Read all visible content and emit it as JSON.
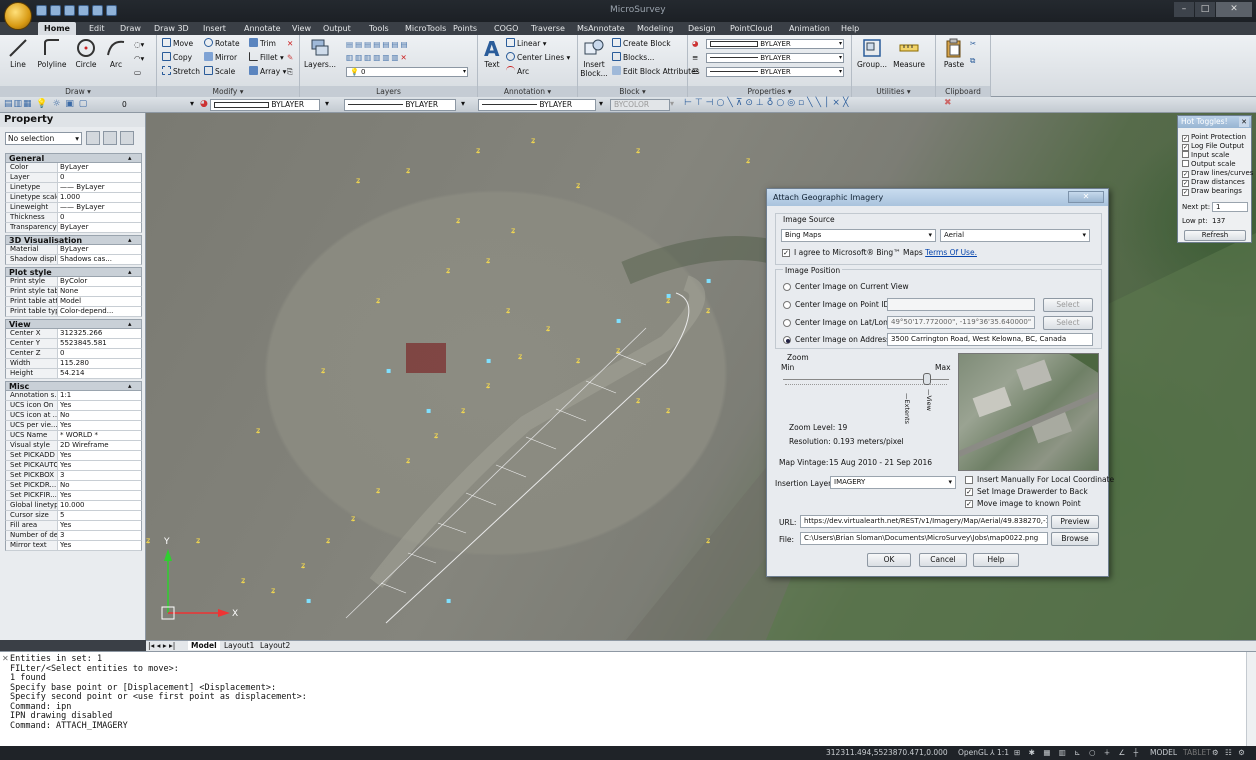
{
  "window": {
    "title": "MicroSurvey",
    "controls": [
      "–",
      "□",
      "✕"
    ]
  },
  "ribbon_tabs": [
    "Home",
    "Edit",
    "Draw",
    "Draw 3D",
    "Insert",
    "Annotate",
    "View",
    "Output",
    "Tools",
    "MicroTools",
    "Points",
    "COGO",
    "Traverse",
    "MsAnnotate",
    "Modeling",
    "Design",
    "PointCloud",
    "Animation",
    "Help"
  ],
  "ribbon": {
    "draw": {
      "label": "Draw",
      "line": "Line",
      "polyline": "Polyline",
      "circle": "Circle",
      "arc": "Arc"
    },
    "modify": {
      "label": "Modify",
      "move": "Move",
      "rotate": "Rotate",
      "trim": "Trim",
      "copy": "Copy",
      "mirror": "Mirror",
      "fillet": "Fillet",
      "stretch": "Stretch",
      "scale": "Scale",
      "array": "Array"
    },
    "layers": {
      "label": "Layers",
      "layers_btn": "Layers...",
      "layer_value": "0"
    },
    "annotation": {
      "label": "Annotation",
      "text": "Text",
      "linear": "Linear",
      "center_lines": "Center Lines",
      "arc": "Arc"
    },
    "block": {
      "label": "Block",
      "insert_block": "Insert Block...",
      "create_block": "Create Block",
      "blocks": "Blocks...",
      "edit_block_attributes": "Edit Block Attributes"
    },
    "properties": {
      "label": "Properties",
      "color": "BYLAYER",
      "linetype": "BYLAYER",
      "lineweight": "BYLAYER"
    },
    "utilities": {
      "label": "Utilities",
      "group": "Group...",
      "measure": "Measure"
    },
    "clipboard": {
      "label": "Clipboard",
      "paste": "Paste"
    }
  },
  "props_toolbar": {
    "layer": "0",
    "color": "BYLAYER",
    "linetype": "BYLAYER",
    "lineweight": "BYLAYER",
    "plotstyle": "BYCOLOR"
  },
  "property_panel": {
    "title": "Property",
    "selection": "No selection",
    "sections": [
      {
        "name": "General",
        "rows": [
          [
            "Color",
            "ByLayer"
          ],
          [
            "Layer",
            "0"
          ],
          [
            "Linetype",
            "—— ByLayer"
          ],
          [
            "Linetype scale",
            "1.000"
          ],
          [
            "Lineweight",
            "—— ByLayer"
          ],
          [
            "Thickness",
            "0"
          ],
          [
            "Transparency",
            "ByLayer"
          ]
        ]
      },
      {
        "name": "3D Visualisation",
        "rows": [
          [
            "Material",
            "ByLayer"
          ],
          [
            "Shadow displ...",
            "Shadows cas..."
          ]
        ]
      },
      {
        "name": "Plot style",
        "rows": [
          [
            "Print style",
            "ByColor"
          ],
          [
            "Print style table",
            "None"
          ],
          [
            "Print table att...",
            "Model"
          ],
          [
            "Print table type",
            "Color-depend..."
          ]
        ]
      },
      {
        "name": "View",
        "rows": [
          [
            "Center X",
            "312325.266"
          ],
          [
            "Center Y",
            "5523845.581"
          ],
          [
            "Center Z",
            "0"
          ],
          [
            "Width",
            "115.280"
          ],
          [
            "Height",
            "54.214"
          ]
        ]
      },
      {
        "name": "Misc",
        "rows": [
          [
            "Annotation s...",
            "1:1"
          ],
          [
            "UCS icon On",
            "Yes"
          ],
          [
            "UCS icon at ...",
            "No"
          ],
          [
            "UCS per vie...",
            "Yes"
          ],
          [
            "UCS Name",
            "* WORLD *"
          ],
          [
            "Visual style",
            "2D Wireframe"
          ],
          [
            "Set PICKADD",
            "Yes"
          ],
          [
            "Set PICKAUTO",
            "Yes"
          ],
          [
            "Set PICKBOX",
            "3"
          ],
          [
            "Set PICKDR...",
            "No"
          ],
          [
            "Set PICKFIR...",
            "Yes"
          ],
          [
            "Global linetyp...",
            "10.000"
          ],
          [
            "Cursor size",
            "5"
          ],
          [
            "Fill area",
            "Yes"
          ],
          [
            "Number of de...",
            "3"
          ],
          [
            "Mirror text",
            "Yes"
          ]
        ]
      }
    ]
  },
  "layout_tabs": [
    "Model",
    "Layout1",
    "Layout2"
  ],
  "ucs": {
    "y": "Y",
    "x": "X"
  },
  "dialog": {
    "title": "Attach Geographic Imagery",
    "image_source_label": "Image Source",
    "source": "Bing Maps",
    "imagery_type": "Aerial",
    "agree_text": "I agree to Microsoft® Bing™ Maps",
    "terms_link": "Terms Of Use.",
    "image_position_label": "Image Position",
    "opt_current_view": "Center Image on Current View",
    "opt_point_id": "Center Image on Point ID:",
    "opt_latlong": "Center Image on Lat/Long:",
    "latlong_value": "49°50'17.772000\", -119°36'35.640000\"",
    "opt_address": "Center Image on Address:",
    "address_value": "3500 Carrington Road, West Kelowna, BC, Canada",
    "select": "Select",
    "zoom_label": "Zoom",
    "zoom_min": "Min",
    "zoom_max": "Max",
    "zoom_extents": "—Extents",
    "zoom_view": "—View",
    "zoom_level": "Zoom Level:  19",
    "resolution": "Resolution:  0.193 meters/pixel",
    "map_vintage_label": "Map Vintage:",
    "map_vintage_value": "15 Aug 2010 - 21 Sep 2016",
    "insertion_layer_label": "Insertion Layer:",
    "insertion_layer_value": "IMAGERY",
    "chk_insert_manually": "Insert Manually For Local Coordinate",
    "chk_drawerder": "Set Image Drawerder to Back",
    "chk_move_known": "Move image to known Point",
    "url_label": "URL:",
    "url_value": "https://dev.virtualearth.net/REST/v1/Imagery/Map/Aerial/49.838270,-119.6",
    "file_label": "File:",
    "file_value": "C:\\Users\\Brian Sloman\\Documents\\MicroSurvey\\Jobs\\map0022.png",
    "preview": "Preview",
    "browse": "Browse",
    "ok": "OK",
    "cancel": "Cancel",
    "help": "Help"
  },
  "hot_toggles": {
    "title": "Hot Toggles!",
    "items": [
      [
        "Point Protection",
        true
      ],
      [
        "Log File Output",
        true
      ],
      [
        "Input scale",
        false
      ],
      [
        "Output scale",
        false
      ],
      [
        "Draw lines/curves",
        true
      ],
      [
        "Draw distances",
        true
      ],
      [
        "Draw bearings",
        true
      ]
    ],
    "next_pt_label": "Next pt:",
    "next_pt_value": "1",
    "low_pt_label": "Low pt:",
    "low_pt_value": "137",
    "refresh": "Refresh"
  },
  "command_lines": [
    "Entities in set: 1",
    "FILter/<Select entities to move>:",
    "1 found",
    "Specify base point or [Displacement] <Displacement>:",
    "Specify second point or <use first point as displacement>:",
    "Command: ipn",
    "IPN drawing disabled",
    "Command: ATTACH_IMAGERY"
  ],
  "status": {
    "coords": "312311.494,5523870.471,0.000",
    "opengl": "OpenGL",
    "scale": "1:1",
    "model": "MODEL",
    "tablet": "TABLET"
  }
}
